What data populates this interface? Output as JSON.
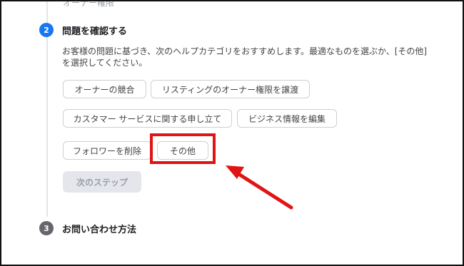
{
  "previous_step_text": "オーナー権限",
  "step2": {
    "number": "2",
    "title": "問題を確認する",
    "description": "お客様の問題に基づき、次のヘルプカテゴリをおすすめします。最適なものを選ぶか、[その他]を選択してください。",
    "options": [
      "オーナーの競合",
      "リスティングのオーナー権限を譲渡",
      "カスタマー サービスに関する申し立て",
      "ビジネス情報を編集",
      "フォロワーを削除",
      "その他"
    ],
    "next_label": "次のステップ"
  },
  "step3": {
    "number": "3",
    "title": "お問い合わせ方法"
  },
  "colors": {
    "accent": "#1877f2",
    "annotation": "#e01414",
    "inactive_step": "#65676b"
  }
}
